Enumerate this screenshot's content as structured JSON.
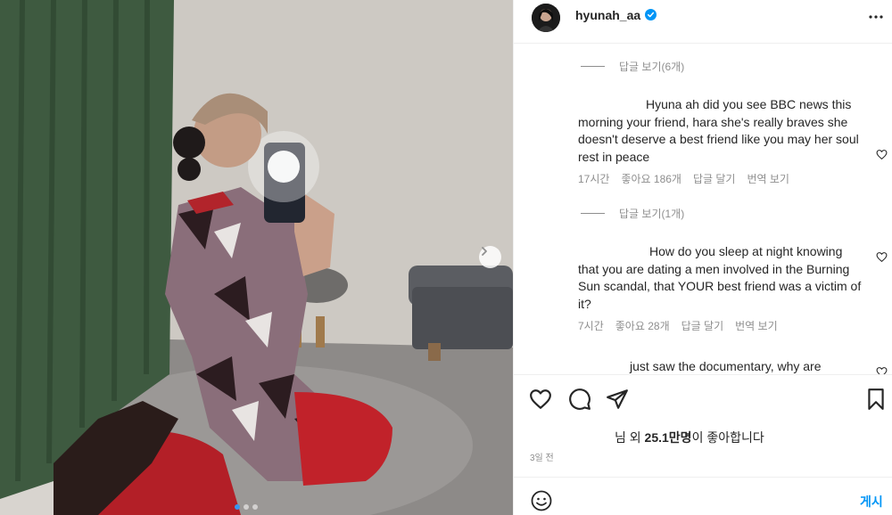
{
  "colors": {
    "link_blue": "#0095f6",
    "meta_gray": "#8e8e8e",
    "text": "#262626",
    "divider": "#efefef"
  },
  "post": {
    "username": "hyunah_aa",
    "verified_icon": "verified-badge-icon",
    "carousel": {
      "total": 3,
      "current": 1
    }
  },
  "comments": [
    {
      "reply_toggle": "답글 보기(6개)",
      "text": "Hyuna ah did you see BBC news this morning your friend, hara she's really braves she doesn't deserve a best friend like you may her soul rest in peace",
      "time": "17시간",
      "likes": "좋아요 186개",
      "reply": "답글 달기",
      "translate": "번역 보기"
    },
    {
      "reply_toggle": "답글 보기(1개)",
      "text": "How do you sleep at night knowing that you are dating a men involved in the Burning Sun scandal, that YOUR best friend was a victim of it?",
      "time": "7시간",
      "likes": "좋아요 28개",
      "reply": "답글 달기",
      "translate": "번역 보기"
    },
    {
      "text": "just saw the documentary, why are"
    }
  ],
  "likes": {
    "prefix": "님 외 ",
    "count": "25.1만명",
    "suffix": "이 좋아합니다"
  },
  "date": "3일 전",
  "composer": {
    "post_label": "게시"
  }
}
